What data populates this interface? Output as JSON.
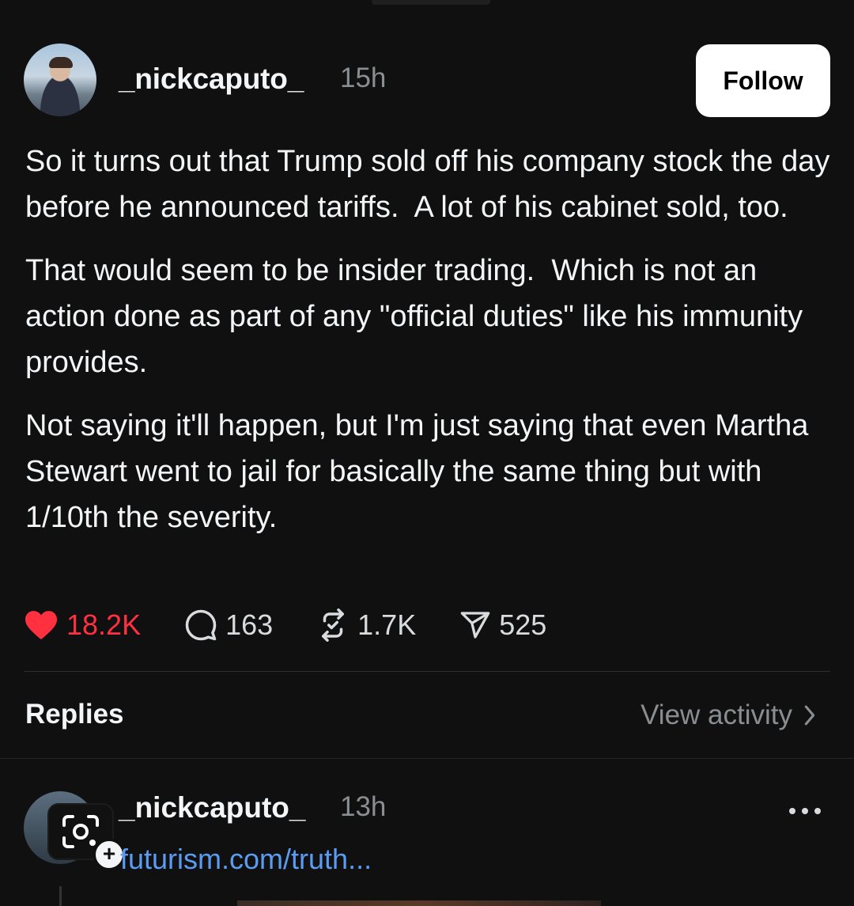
{
  "post": {
    "username": "_nickcaputo_",
    "time": "15h",
    "follow_label": "Follow",
    "paragraphs": [
      "So it turns out that Trump sold off his company stock the day before he announced tariffs.  A lot of his cabinet sold, too.",
      "That would seem to be insider trading.  Which is not an action done as part of any \"official duties\" like his immunity provides.",
      "Not saying it'll happen, but I'm just saying that even Martha Stewart went to jail for basically the same thing but with 1/10th the severity."
    ],
    "stats": {
      "likes": "18.2K",
      "comments": "163",
      "reposts": "1.7K",
      "shares": "525"
    }
  },
  "replies_section": {
    "label": "Replies",
    "view_activity": "View activity"
  },
  "reply": {
    "username": "_nickcaputo_",
    "time": "13h",
    "link_text": "futurism.com/truth..."
  },
  "colors": {
    "background": "#101010",
    "like": "#ff3040",
    "link": "#5b9cf2",
    "muted": "#8a8d91"
  }
}
